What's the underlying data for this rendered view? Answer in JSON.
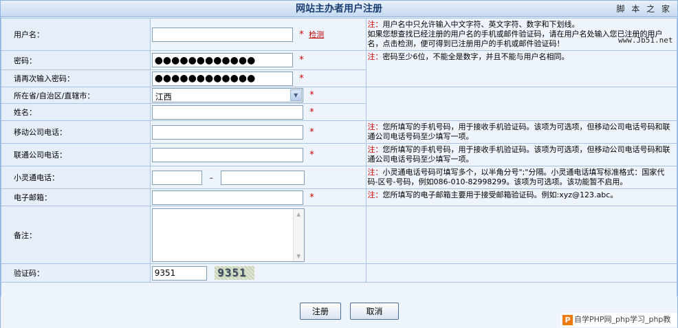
{
  "header": {
    "title": "网站主办者用户注册",
    "watermark": "脚 本 之 家",
    "watermark_url": "www.Jb51.net"
  },
  "note_prefix": "注：",
  "rows": {
    "username": {
      "label": "用户名：",
      "value": "",
      "required": "*",
      "link": "检测",
      "note": "用户名中只允许输入中文字符、英文字符、数字和下划线。",
      "note2": "如果您想查找已经注册的用户名的手机或邮件验证码，请在用户名处输入您已注册的用户名，点击检测，便可得到已注册用户的手机或邮件验证码！"
    },
    "password": {
      "label": "密码：",
      "value": "●●●●●●●●●●●●",
      "required": "*",
      "note": "密码至少6位，不能全是数字，并且不能与用户名相同。"
    },
    "password_confirm": {
      "label": "请再次输入密码：",
      "value": "●●●●●●●●●●●●",
      "required": "*"
    },
    "province": {
      "label": "所在省/自治区/直辖市：",
      "value": "江西",
      "required": "*"
    },
    "name": {
      "label": "姓名：",
      "value": "",
      "required": "*"
    },
    "mobile": {
      "label": "移动公司电话：",
      "value": "",
      "required": "*",
      "note": "您所填写的手机号码，用于接收手机验证码。该项为可选项，但移动公司电话号码和联通公司电话号码至少填写一项。"
    },
    "unicom": {
      "label": "联通公司电话：",
      "value": "",
      "required": "*",
      "note": "您所填写的手机号码，用于接收手机验证码。该项为可选项，但移动公司电话号码和联通公司电话号码至少填写一项。"
    },
    "phs": {
      "label": "小灵通电话：",
      "value_area": "",
      "separator": "–",
      "value_number": "",
      "note": "小灵通电话号码可填写多个，以半角分号\";\"分隔。小灵通电话填写标准格式：国家代码-区号-号码，例如086-010-82998299。该项为可选项。该功能暂不启用。"
    },
    "email": {
      "label": "电子邮箱：",
      "value": "",
      "required": "*",
      "note": "您所填写的电子邮箱主要用于接受邮箱验证码。例如:xyz@123.abc。"
    },
    "remark": {
      "label": "备注：",
      "value": ""
    },
    "captcha": {
      "label": "验证码：",
      "value": "9351",
      "image_text": "9351"
    }
  },
  "buttons": {
    "submit": "注册",
    "cancel": "取消"
  },
  "footer_badge": {
    "icon": "P",
    "text": "自学PHP网_php学习_php教"
  }
}
